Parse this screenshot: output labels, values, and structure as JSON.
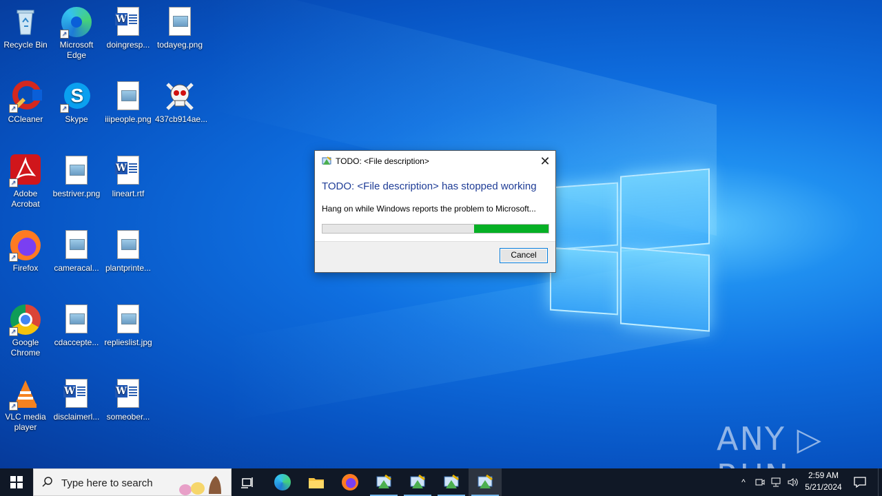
{
  "desktop_icons": [
    {
      "label": "Recycle Bin",
      "icon": "recycle-bin-icon"
    },
    {
      "label": "Microsoft Edge",
      "icon": "edge-icon"
    },
    {
      "label": "doingresp...",
      "icon": "word-doc-icon"
    },
    {
      "label": "todayeg.png",
      "icon": "image-file-icon"
    },
    {
      "label": "CCleaner",
      "icon": "ccleaner-icon"
    },
    {
      "label": "Skype",
      "icon": "skype-icon"
    },
    {
      "label": "iiipeople.png",
      "icon": "image-file-icon"
    },
    {
      "label": "437cb914ae...",
      "icon": "skull-icon"
    },
    {
      "label": "Adobe Acrobat",
      "icon": "acrobat-icon"
    },
    {
      "label": "bestriver.png",
      "icon": "image-file-icon"
    },
    {
      "label": "lineart.rtf",
      "icon": "word-doc-icon"
    },
    {
      "label": "Firefox",
      "icon": "firefox-icon"
    },
    {
      "label": "cameracal...",
      "icon": "image-file-icon"
    },
    {
      "label": "plantprinte...",
      "icon": "image-file-icon"
    },
    {
      "label": "Google Chrome",
      "icon": "chrome-icon"
    },
    {
      "label": "cdaccepte...",
      "icon": "image-file-icon"
    },
    {
      "label": "replieslist.jpg",
      "icon": "image-file-icon"
    },
    {
      "label": "VLC media player",
      "icon": "vlc-icon"
    },
    {
      "label": "disclaimerl...",
      "icon": "word-doc-icon"
    },
    {
      "label": "someober...",
      "icon": "word-doc-icon"
    }
  ],
  "dialog": {
    "title": "TODO: <File description>",
    "heading": "TODO: <File description> has stopped working",
    "message": "Hang on while Windows reports the problem to Microsoft...",
    "cancel_label": "Cancel",
    "close_glyph": "✕",
    "progress_fraction": 0.33
  },
  "watermark": "ANY ▷ RUN",
  "taskbar": {
    "search_placeholder": "Type here to search",
    "pinned": [
      "task-view-icon",
      "edge-icon",
      "file-explorer-icon",
      "firefox-icon",
      "app-icon",
      "app-icon",
      "app-icon",
      "app-icon"
    ],
    "tray_chevron": "^",
    "clock_time": "2:59 AM",
    "clock_date": "5/21/2024"
  },
  "colors": {
    "accent": "#0078d7",
    "progress_green": "#06b025",
    "taskbar_bg": "#101826",
    "dialog_heading": "#1e3c96"
  }
}
